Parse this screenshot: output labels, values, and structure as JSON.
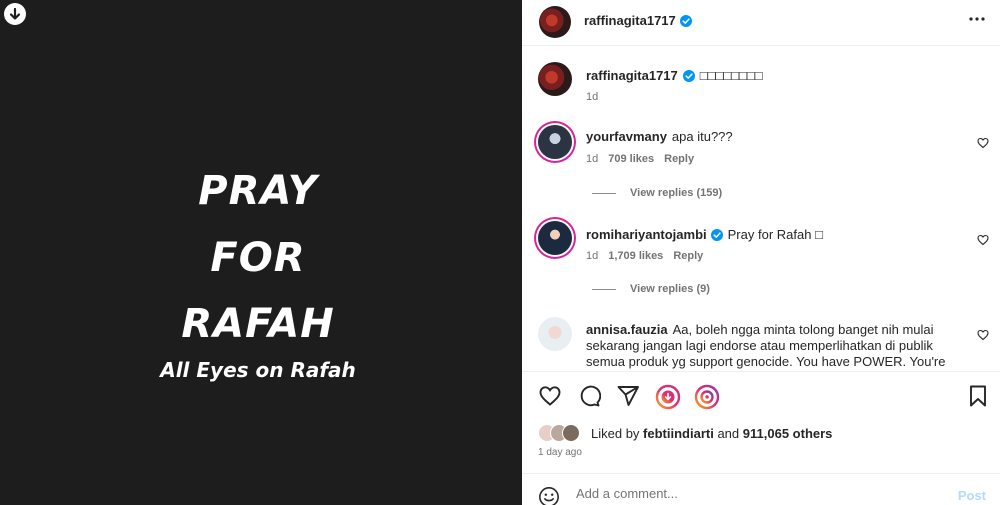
{
  "media": {
    "download_icon": "arrow-down-circle-icon",
    "poster": {
      "line1": "PRAY",
      "line2": "FOR",
      "line3": "RAFAH",
      "tagline": "All Eyes on Rafah"
    }
  },
  "header": {
    "username": "raffinagita1717",
    "verified": true,
    "more_icon": "more-horizontal-icon"
  },
  "caption": {
    "username": "raffinagita1717",
    "text": "□□□□□□□□",
    "time": "1d"
  },
  "comments": [
    {
      "username": "yourfavmany",
      "text": "apa itu???",
      "time": "1d",
      "likes": "709 likes",
      "reply": "Reply",
      "view_replies": "View replies (159)"
    },
    {
      "username": "romihariyantojambi",
      "verified": true,
      "text": "Pray for Rafah □",
      "time": "1d",
      "likes": "1,709 likes",
      "reply": "Reply",
      "view_replies": "View replies (9)"
    },
    {
      "username": "annisa.fauzia",
      "text": "Aa, boleh ngga minta tolong banget nih mulai sekarang jangan lagi endorse atau memperlihatkan di publik semua produk yg support genocide. You have POWER. You're"
    }
  ],
  "actions": {
    "icons": [
      "heart-icon",
      "comment-icon",
      "share-icon",
      "tip-icon",
      "remix-icon",
      "bookmark-icon"
    ]
  },
  "likes": {
    "prefix": "Liked by",
    "user": "febtiindiarti",
    "and": "and",
    "count": "911,065 others"
  },
  "time_ago": "1 day ago",
  "add_comment": {
    "placeholder": "Add a comment...",
    "post_label": "Post"
  },
  "colors": {
    "media_bg": "#1d1d1d",
    "verified_blue": "#0095f6",
    "post_disabled": "#b3dbff",
    "muted_text": "#737373"
  }
}
